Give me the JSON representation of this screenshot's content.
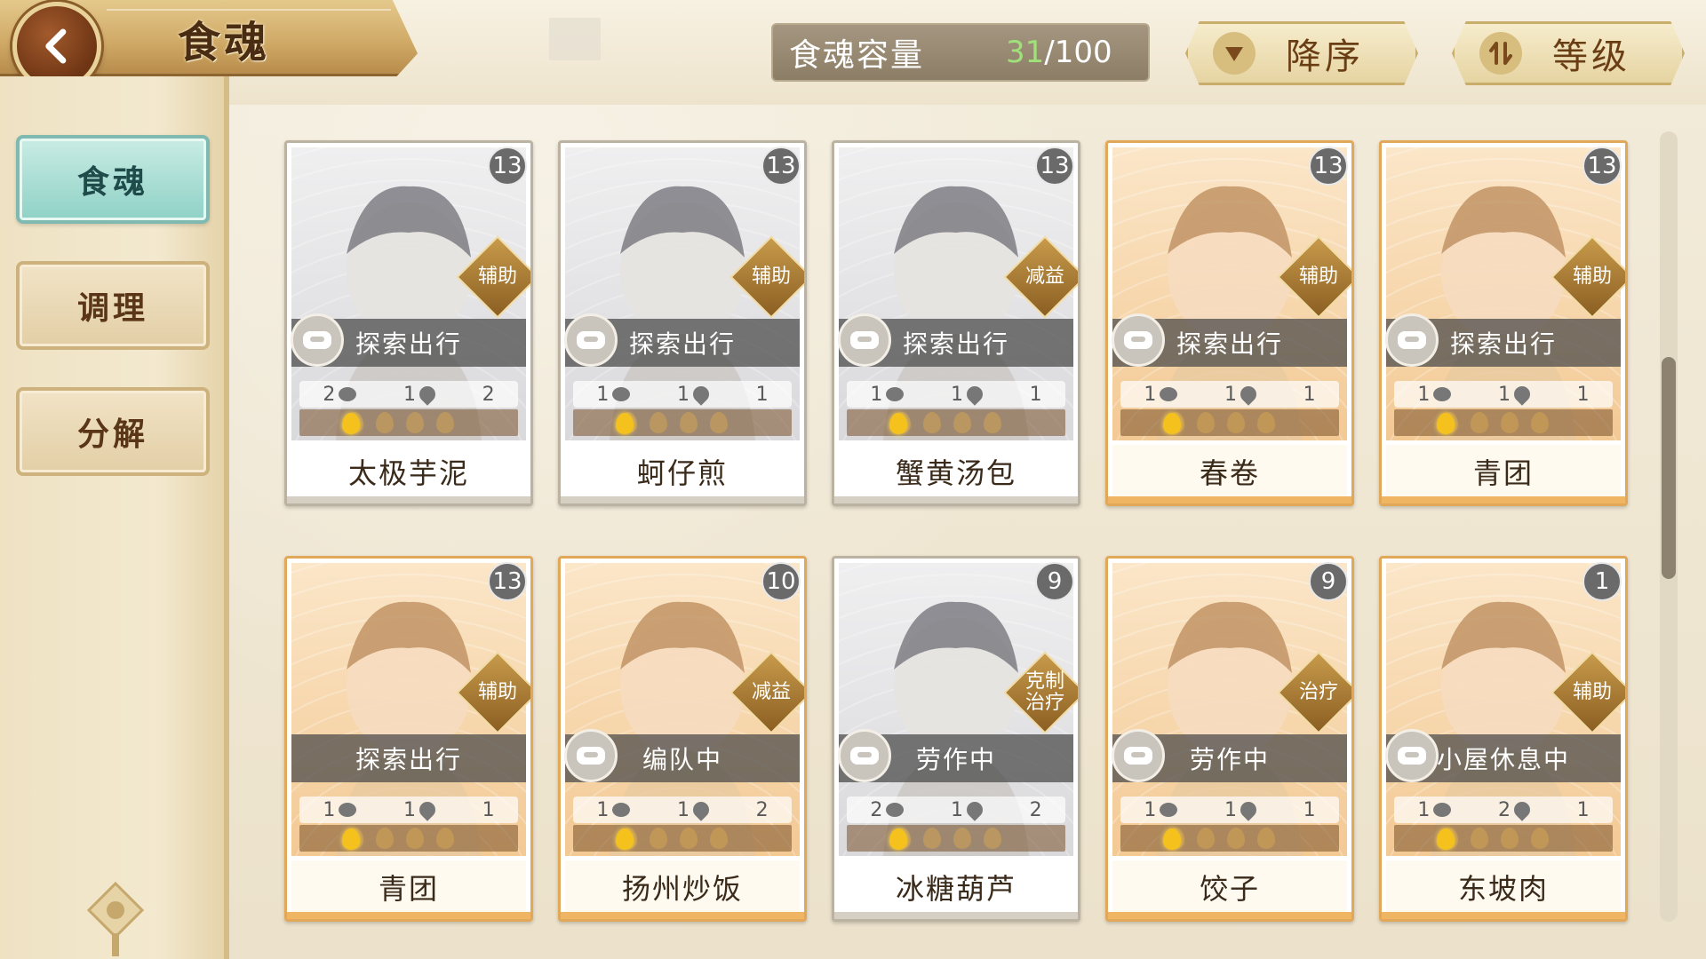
{
  "header": {
    "title": "食魂",
    "capacity_label": "食魂容量",
    "capacity_current": "31",
    "capacity_total": "/100",
    "sort_order_label": "降序",
    "sort_field_label": "等级"
  },
  "sidebar": {
    "items": [
      {
        "label": "食魂",
        "active": true
      },
      {
        "label": "调理",
        "active": false
      },
      {
        "label": "分解",
        "active": false
      }
    ]
  },
  "cards": [
    {
      "name": "太极芋泥",
      "level": "13",
      "role": "辅助",
      "status": "探索出行",
      "stat1": "2",
      "stat2": "1",
      "stat3": "2",
      "theme": "grey"
    },
    {
      "name": "蚵仔煎",
      "level": "13",
      "role": "辅助",
      "status": "探索出行",
      "stat1": "1",
      "stat2": "1",
      "stat3": "1",
      "theme": "grey"
    },
    {
      "name": "蟹黄汤包",
      "level": "13",
      "role": "减益",
      "status": "探索出行",
      "stat1": "1",
      "stat2": "1",
      "stat3": "1",
      "theme": "grey"
    },
    {
      "name": "春卷",
      "level": "13",
      "role": "辅助",
      "status": "探索出行",
      "stat1": "1",
      "stat2": "1",
      "stat3": "1",
      "theme": "orange"
    },
    {
      "name": "青团",
      "level": "13",
      "role": "辅助",
      "status": "探索出行",
      "stat1": "1",
      "stat2": "1",
      "stat3": "1",
      "theme": "orange"
    },
    {
      "name": "青团",
      "level": "13",
      "role": "辅助",
      "status": "探索出行",
      "stat1": "1",
      "stat2": "1",
      "stat3": "1",
      "theme": "orange"
    },
    {
      "name": "扬州炒饭",
      "level": "10",
      "role": "减益",
      "status": "编队中",
      "stat1": "1",
      "stat2": "1",
      "stat3": "2",
      "theme": "orange"
    },
    {
      "name": "冰糖葫芦",
      "level": "9",
      "role": "克制\n治疗",
      "status": "劳作中",
      "stat1": "2",
      "stat2": "1",
      "stat3": "2",
      "theme": "grey"
    },
    {
      "name": "饺子",
      "level": "9",
      "role": "治疗",
      "status": "劳作中",
      "stat1": "1",
      "stat2": "1",
      "stat3": "1",
      "theme": "orange"
    },
    {
      "name": "东坡肉",
      "level": "1",
      "role": "辅助",
      "status": "小屋休息中",
      "stat1": "1",
      "stat2": "2",
      "stat3": "1",
      "theme": "orange"
    }
  ],
  "colors": {
    "accent_teal": "#8fd1c6",
    "capacity_current": "#9fe27a",
    "card_gold_border": "#e2a85a"
  }
}
